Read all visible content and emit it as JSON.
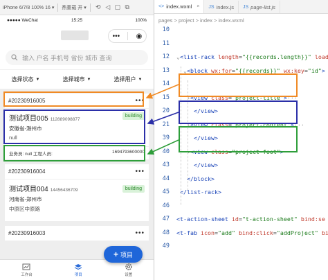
{
  "simulator": {
    "device": "iPhone 6/7/8 100% 16 ▾",
    "hot_reload": "热重载 开 ▾"
  },
  "phone": {
    "status_left": "●●●●● WeChat",
    "status_time": "15:25",
    "status_right": "100%",
    "capsule_more": "•••",
    "capsule_close": "◉",
    "search_placeholder": "输入 户名 手机号 省份 城市 查询",
    "filters": [
      "选择状态",
      "选择城市",
      "选择用户"
    ],
    "cards": [
      {
        "no": "#20230916005",
        "more": "•••",
        "name": "测试项目005",
        "phone": "112889098877",
        "status": "building",
        "location": "安徽省-滁州市",
        "address": "null",
        "staff": "业务员: null 工程人员:",
        "ts": "1694793600000"
      },
      {
        "no": "#20230916004",
        "more": "•••",
        "name": "测试项目004",
        "phone": "14456436709",
        "status": "building",
        "location": "河南省-郑州市",
        "address": "中原区中原路"
      },
      {
        "no": "#20230916003",
        "more": "•••"
      }
    ],
    "fab_label": "项目",
    "fab_plus": "+",
    "tabs": [
      "工作台",
      "项目",
      "设置"
    ]
  },
  "editor": {
    "tabs": [
      {
        "lang": "<>",
        "name": "index.wxml",
        "close": "×"
      },
      {
        "lang": "JS",
        "name": "index.js"
      },
      {
        "lang": "JS",
        "name": "page-list.js"
      }
    ],
    "breadcrumb": "pages > project > index > index.wxml",
    "lines": [
      {
        "n": "10",
        "html": ""
      },
      {
        "n": "11",
        "html": ""
      },
      {
        "n": "12",
        "html": "<span class=\"fold\">⌄</span><span class=\"t\">&lt;list-rack</span> <span class=\"a\">length</span>=<span class=\"s\">\"{{records.length}}\"</span> <span class=\"a\">load</span>"
      },
      {
        "n": "13",
        "html": "  <span class=\"fold\">⌄</span><span class=\"t\">&lt;block</span> <span class=\"a\">wx:for</span>=<span class=\"s\">\"{{records}}\"</span> <span class=\"a\">wx:key</span>=<span class=\"s\">\"id\"</span><span class=\"t\">&gt;</span>"
      },
      {
        "n": "14",
        "html": ""
      },
      {
        "n": "15",
        "html": "   <span class=\"fold\">›</span><span class=\"t\">&lt;view</span> <span class=\"a\">class</span>=<span class=\"s\">\"project-title\"</span><span class=\"t\">&gt;</span><span class=\"fold\">···</span>"
      },
      {
        "n": "20",
        "html": "     <span class=\"t\">&lt;/view&gt;</span>"
      },
      {
        "n": "21",
        "html": "   <span class=\"fold\">›</span><span class=\"t\">&lt;view</span> <span class=\"a\">class</span>=<span class=\"s\">\"project-content\"</span><span class=\"t\">&gt;</span><span class=\"fold\">···</span>"
      },
      {
        "n": "39",
        "html": "     <span class=\"t\">&lt;/view&gt;</span>"
      },
      {
        "n": "40",
        "html": "   <span class=\"fold\">›</span><span class=\"t\">&lt;view</span> <span class=\"a\">class</span>=<span class=\"s\">\"project-foot\"</span><span class=\"t\">&gt;</span><span class=\"fold\">···</span>"
      },
      {
        "n": "43",
        "html": "     <span class=\"t\">&lt;/view&gt;</span>"
      },
      {
        "n": "44",
        "html": "   <span class=\"t\">&lt;/block&gt;</span>"
      },
      {
        "n": "45",
        "html": " <span class=\"t\">&lt;/list-rack&gt;</span>"
      },
      {
        "n": "46",
        "html": ""
      },
      {
        "n": "47",
        "html": "<span class=\"t\">&lt;t-action-sheet</span> <span class=\"a\">id</span>=<span class=\"s\">\"t-action-sheet\"</span> <span class=\"a\">bind:se</span>"
      },
      {
        "n": "48",
        "html": "<span class=\"t\">&lt;t-fab</span> <span class=\"a\">icon</span>=<span class=\"s\">\"add\"</span> <span class=\"a\">bind:click</span>=<span class=\"s\">\"addProject\"</span> <span class=\"a\">bind:</span>"
      },
      {
        "n": "49",
        "html": ""
      }
    ]
  },
  "colors": {
    "title_box": "#f08a24",
    "content_box": "#2b2fa8",
    "foot_box": "#2e9e3a",
    "primary": "#1f66d9"
  }
}
